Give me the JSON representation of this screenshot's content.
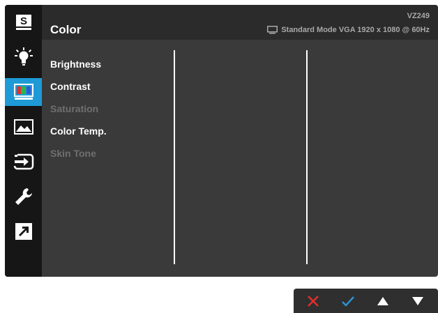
{
  "osd": {
    "title": "Color",
    "model": "VZ249",
    "status": "Standard Mode VGA  1920 x 1080 @ 60Hz"
  },
  "sidebar": {
    "items": [
      {
        "icon": "splendid-s-icon",
        "label": "S"
      },
      {
        "icon": "brightness-bulb-icon"
      },
      {
        "icon": "color-bars-icon",
        "active": true
      },
      {
        "icon": "image-landscape-icon"
      },
      {
        "icon": "input-select-icon"
      },
      {
        "icon": "wrench-icon"
      },
      {
        "icon": "shortcut-arrow-icon"
      }
    ]
  },
  "menu": {
    "items": [
      {
        "label": "Brightness",
        "enabled": true
      },
      {
        "label": "Contrast",
        "enabled": true
      },
      {
        "label": "Saturation",
        "enabled": false
      },
      {
        "label": "Color Temp.",
        "enabled": true
      },
      {
        "label": "Skin Tone",
        "enabled": false
      }
    ]
  },
  "nav": {
    "buttons": [
      {
        "icon": "close-x-icon",
        "color": "#e0302e"
      },
      {
        "icon": "check-icon",
        "color": "#2a93d5"
      },
      {
        "icon": "up-triangle-icon",
        "color": "#ffffff"
      },
      {
        "icon": "down-triangle-icon",
        "color": "#ffffff"
      }
    ]
  },
  "colors": {
    "accent": "#1e9bd7",
    "panel": "#3a3a3a",
    "header": "#2b2b2b",
    "sidebar": "#161616",
    "disabled_text": "#6f6f6f"
  }
}
